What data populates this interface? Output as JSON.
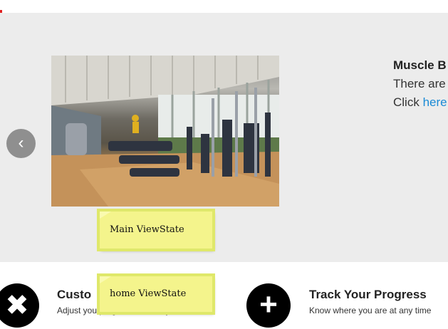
{
  "carousel": {
    "prev_icon": "chevron-left-icon",
    "prev_glyph": "‹",
    "slide": {
      "title": "Muscle B",
      "line1": "There are",
      "line2_prefix": "Click ",
      "link_text": "here"
    }
  },
  "annotations": {
    "main": "Main ViewState",
    "home": "home ViewState"
  },
  "features": [
    {
      "icon": "arrows-out-icon",
      "glyph": "✖",
      "title": "Custo",
      "desc": "Adjust you program on a daily basis."
    },
    {
      "icon": "plus-icon",
      "glyph": "+",
      "title": "Track Your Progress",
      "desc": "Know where you are at any time"
    }
  ],
  "colors": {
    "carousel_bg": "#ececec",
    "link": "#1a8ad6",
    "sticky_note": "#f4f48c"
  }
}
